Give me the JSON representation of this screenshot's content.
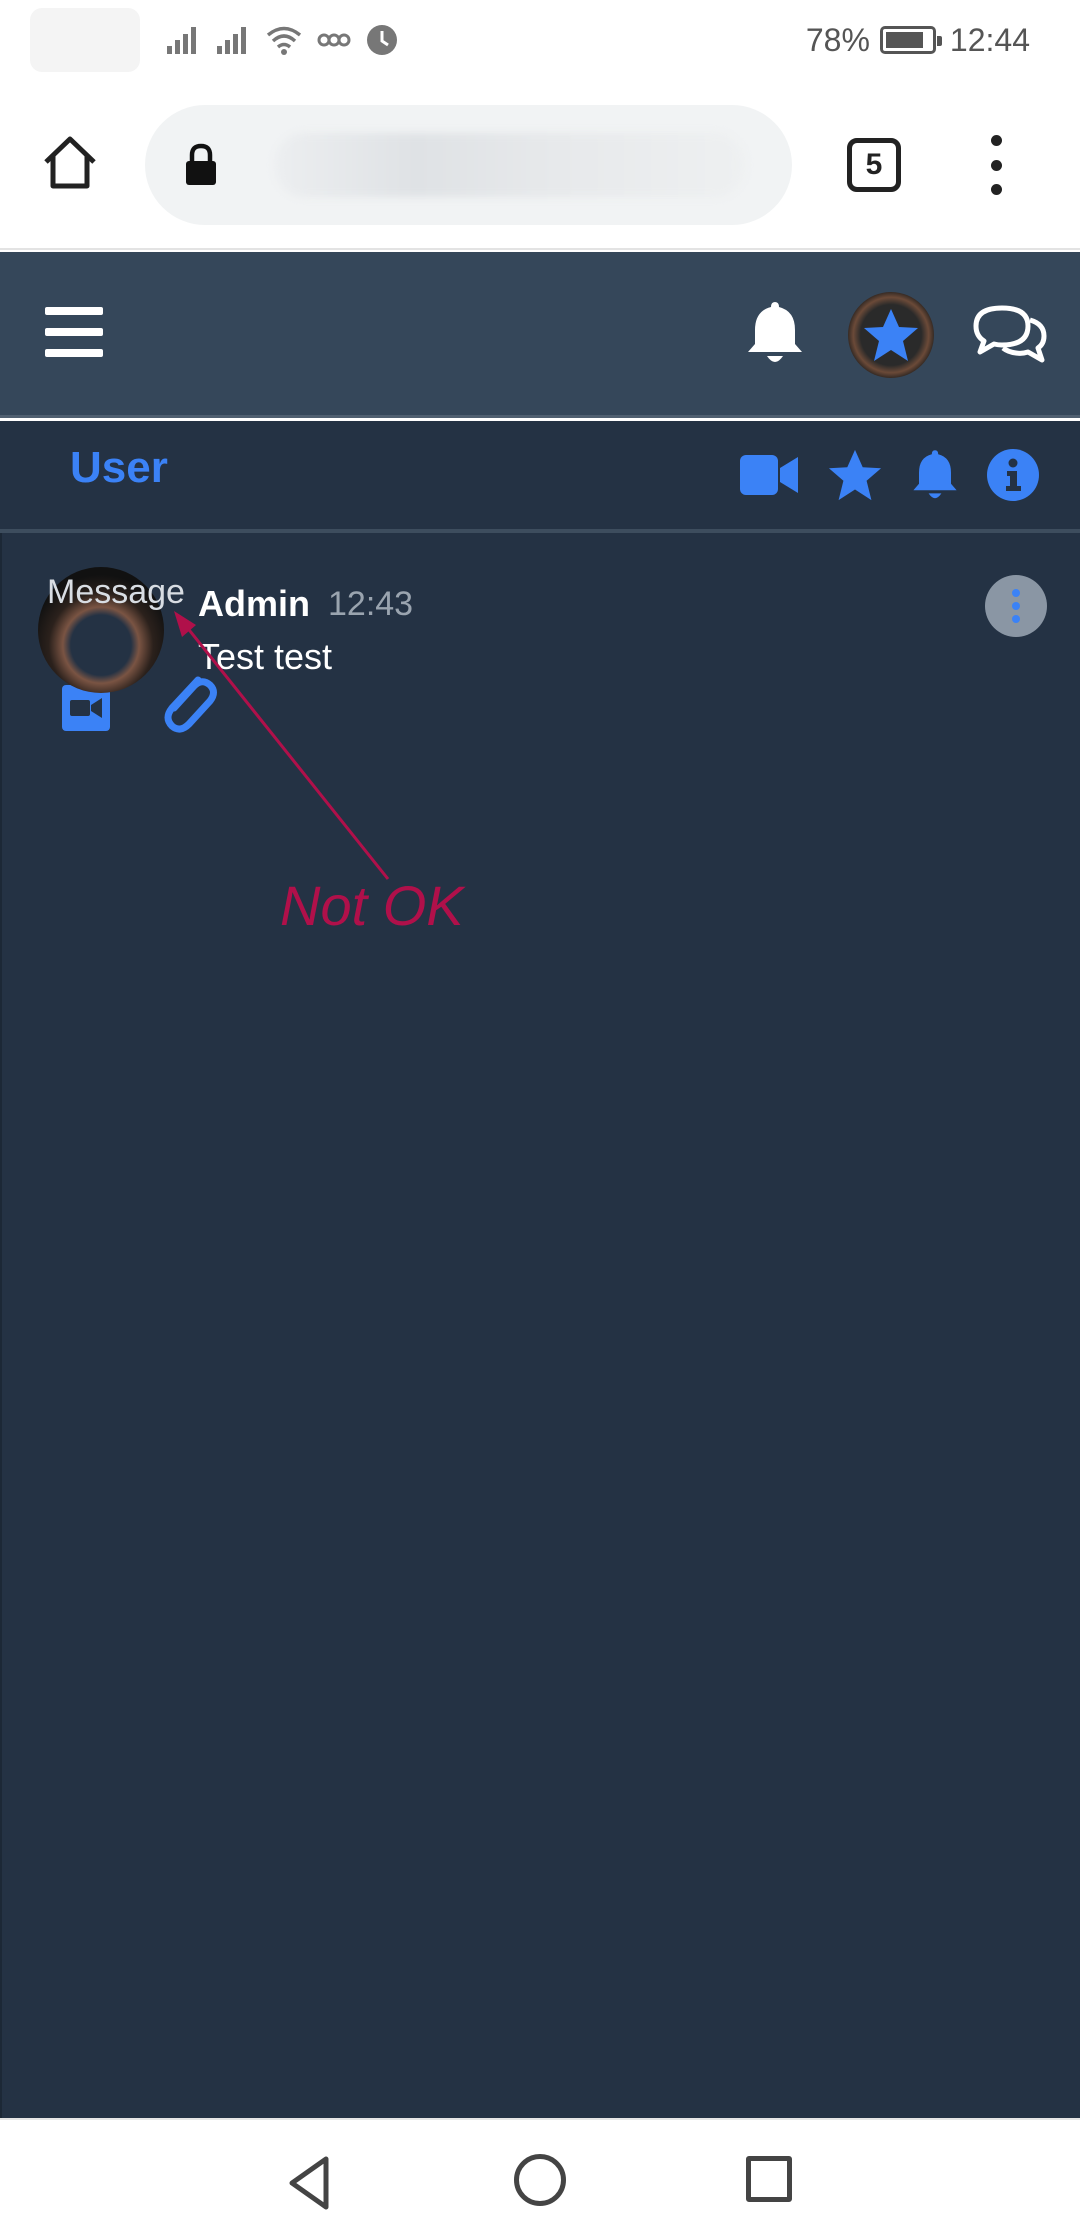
{
  "status_bar": {
    "battery": "78%",
    "time": "12:44",
    "icons": [
      "signal-icon",
      "signal-icon",
      "wifi-icon",
      "link-icon",
      "clock-app-icon"
    ]
  },
  "browser": {
    "tab_count": "5",
    "icons": [
      "home-icon",
      "lock-icon",
      "tabs-icon",
      "menu-icon"
    ]
  },
  "app_header": {
    "icons": [
      "menu-icon",
      "bell-icon",
      "avatar",
      "chat-icon"
    ]
  },
  "sub_header": {
    "title": "User",
    "icons": [
      "video-icon",
      "star-icon",
      "bell-icon",
      "info-icon"
    ]
  },
  "message": {
    "placeholder_label": "Message",
    "author": "Admin",
    "time": "12:43",
    "text": "Test test"
  },
  "annotation": {
    "text": "Not OK",
    "color": "#b0104a"
  },
  "colors": {
    "accent": "#3b82f6",
    "header_bg": "#35475a",
    "content_bg": "#243244"
  }
}
